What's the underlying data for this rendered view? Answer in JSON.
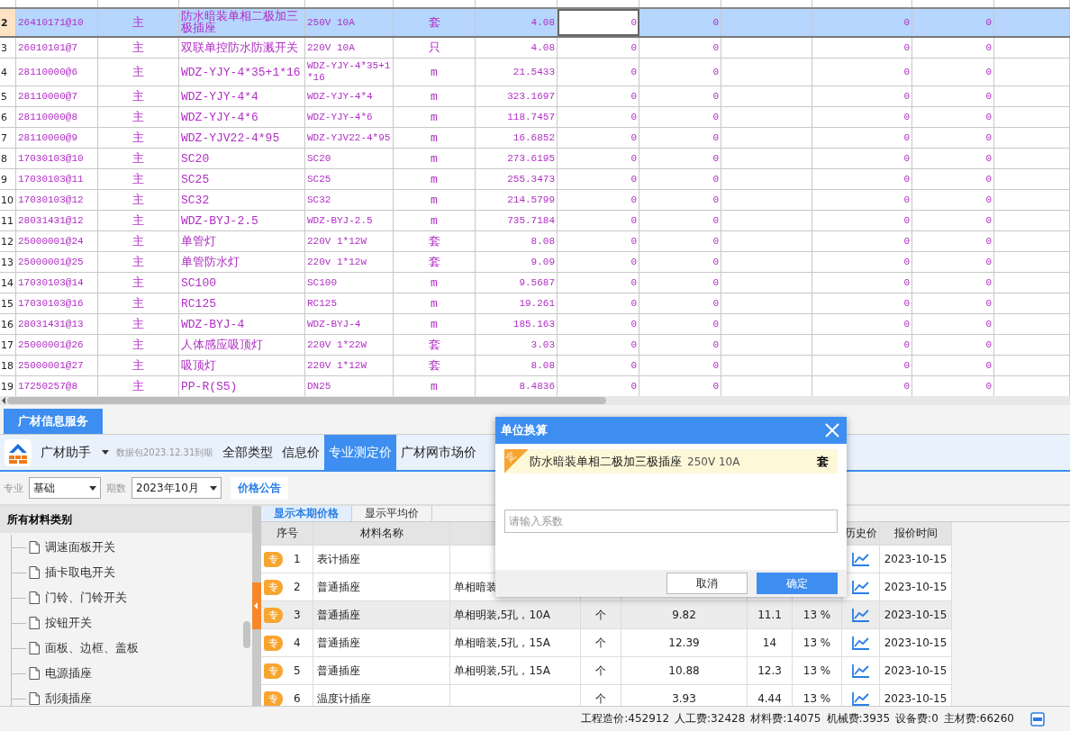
{
  "grid": {
    "rows": [
      {
        "num": "2",
        "code": "26410171@10",
        "type": "主",
        "name": "防水暗装单相二极加三极插座",
        "spec": "250V 10A",
        "unit": "套",
        "qty": "4.08",
        "column_7": "0",
        "column_8": "0",
        "column_10": "0",
        "column_11": "0",
        "selected": true
      },
      {
        "num": "3",
        "code": "26010101@7",
        "type": "主",
        "name": "双联单控防水防溅开关",
        "spec": "220V 10A",
        "unit": "只",
        "qty": "4.08",
        "column_7": "0",
        "column_8": "0",
        "column_10": "0",
        "column_11": "0",
        "selected": false
      },
      {
        "num": "4",
        "code": "28110000@6",
        "type": "主",
        "name": "WDZ-YJY-4*35+1*16",
        "spec": "WDZ-YJY-4*35+1*16",
        "unit": "m",
        "qty": "21.5433",
        "column_7": "0",
        "column_8": "0",
        "column_10": "0",
        "column_11": "0",
        "selected": false
      },
      {
        "num": "5",
        "code": "28110000@7",
        "type": "主",
        "name": "WDZ-YJY-4*4",
        "spec": "WDZ-YJY-4*4",
        "unit": "m",
        "qty": "323.1697",
        "column_7": "0",
        "column_8": "0",
        "column_10": "0",
        "column_11": "0",
        "selected": false
      },
      {
        "num": "6",
        "code": "28110000@8",
        "type": "主",
        "name": "WDZ-YJY-4*6",
        "spec": "WDZ-YJY-4*6",
        "unit": "m",
        "qty": "118.7457",
        "column_7": "0",
        "column_8": "0",
        "column_10": "0",
        "column_11": "0",
        "selected": false
      },
      {
        "num": "7",
        "code": "28110000@9",
        "type": "主",
        "name": "WDZ-YJV22-4*95",
        "spec": "WDZ-YJV22-4*95",
        "unit": "m",
        "qty": "16.6852",
        "column_7": "0",
        "column_8": "0",
        "column_10": "0",
        "column_11": "0",
        "selected": false
      },
      {
        "num": "8",
        "code": "17030103@10",
        "type": "主",
        "name": "SC20",
        "spec": "SC20",
        "unit": "m",
        "qty": "273.6195",
        "column_7": "0",
        "column_8": "0",
        "column_10": "0",
        "column_11": "0",
        "selected": false
      },
      {
        "num": "9",
        "code": "17030103@11",
        "type": "主",
        "name": "SC25",
        "spec": "SC25",
        "unit": "m",
        "qty": "255.3473",
        "column_7": "0",
        "column_8": "0",
        "column_10": "0",
        "column_11": "0",
        "selected": false
      },
      {
        "num": "10",
        "code": "17030103@12",
        "type": "主",
        "name": "SC32",
        "spec": "SC32",
        "unit": "m",
        "qty": "214.5799",
        "column_7": "0",
        "column_8": "0",
        "column_10": "0",
        "column_11": "0",
        "selected": false
      },
      {
        "num": "11",
        "code": "28031431@12",
        "type": "主",
        "name": "WDZ-BYJ-2.5",
        "spec": "WDZ-BYJ-2.5",
        "unit": "m",
        "qty": "735.7184",
        "column_7": "0",
        "column_8": "0",
        "column_10": "0",
        "column_11": "0",
        "selected": false
      },
      {
        "num": "12",
        "code": "25000001@24",
        "type": "主",
        "name": "单管灯",
        "spec": "220V 1*12W",
        "unit": "套",
        "qty": "8.08",
        "column_7": "0",
        "column_8": "0",
        "column_10": "0",
        "column_11": "0",
        "selected": false
      },
      {
        "num": "13",
        "code": "25000001@25",
        "type": "主",
        "name": "单管防水灯",
        "spec": "220v 1*12w",
        "unit": "套",
        "qty": "9.09",
        "column_7": "0",
        "column_8": "0",
        "column_10": "0",
        "column_11": "0",
        "selected": false
      },
      {
        "num": "14",
        "code": "17030103@14",
        "type": "主",
        "name": "SC100",
        "spec": "SC100",
        "unit": "m",
        "qty": "9.5687",
        "column_7": "0",
        "column_8": "0",
        "column_10": "0",
        "column_11": "0",
        "selected": false
      },
      {
        "num": "15",
        "code": "17030103@16",
        "type": "主",
        "name": "RC125",
        "spec": "RC125",
        "unit": "m",
        "qty": "19.261",
        "column_7": "0",
        "column_8": "0",
        "column_10": "0",
        "column_11": "0",
        "selected": false
      },
      {
        "num": "16",
        "code": "28031431@13",
        "type": "主",
        "name": "WDZ-BYJ-4",
        "spec": "WDZ-BYJ-4",
        "unit": "m",
        "qty": "185.163",
        "column_7": "0",
        "column_8": "0",
        "column_10": "0",
        "column_11": "0",
        "selected": false
      },
      {
        "num": "17",
        "code": "25000001@26",
        "type": "主",
        "name": "人体感应吸顶灯",
        "spec": "220V 1*22W",
        "unit": "套",
        "qty": "3.03",
        "column_7": "0",
        "column_8": "0",
        "column_10": "0",
        "column_11": "0",
        "selected": false
      },
      {
        "num": "18",
        "code": "25000001@27",
        "type": "主",
        "name": "吸顶灯",
        "spec": "220V 1*12W",
        "unit": "套",
        "qty": "8.08",
        "column_7": "0",
        "column_8": "0",
        "column_10": "0",
        "column_11": "0",
        "selected": false
      },
      {
        "num": "19",
        "code": "17250257@8",
        "type": "主",
        "name": "PP-R(S5)",
        "spec": "DN25",
        "unit": "m",
        "qty": "8.4836",
        "column_7": "0",
        "column_8": "0",
        "column_10": "0",
        "column_11": "0",
        "selected": false
      }
    ]
  },
  "info_panel": {
    "tab": "广材信息服务",
    "assistant": "广材助手",
    "expiry": "数据包2023.12.31到期",
    "tabs": [
      {
        "label": "全部类型",
        "selected": false
      },
      {
        "label": "信息价",
        "selected": false
      },
      {
        "label": "专业测定价",
        "selected": true
      },
      {
        "label": "广材网市场价",
        "selected": false
      }
    ],
    "filters": [
      {
        "label": "专业",
        "value": "基础"
      },
      {
        "label": "期数",
        "value": "2023年10月"
      }
    ],
    "announcement_button": "价格公告"
  },
  "categories": {
    "title": "所有材料类别",
    "items": [
      "调速面板开关",
      "插卡取电开关",
      "门铃、门铃开关",
      "按钮开关",
      "面板、边框、盖板",
      "电源插座",
      "刮须插座"
    ]
  },
  "price_table": {
    "view_tabs": [
      {
        "label": "显示本期价格",
        "selected": true
      },
      {
        "label": "显示平均价",
        "selected": false
      }
    ],
    "columns": {
      "index": "序号",
      "name": "材料名称",
      "history": "历史价",
      "date": "报价时间"
    },
    "rows": [
      {
        "badge": "专",
        "index": "1",
        "name": "表计插座",
        "date": "2023-10-15",
        "selected": false
      },
      {
        "badge": "专",
        "index": "2",
        "name": "普通插座",
        "spec": "单相暗装",
        "date": "2023-10-15",
        "selected": false
      },
      {
        "badge": "专",
        "index": "3",
        "name": "普通插座",
        "spec": "单相明装,5孔，10A",
        "unit": "个",
        "price": "9.82",
        "tax_price": "11.1",
        "tax": "13 %",
        "date": "2023-10-15",
        "selected": true
      },
      {
        "badge": "专",
        "index": "4",
        "name": "普通插座",
        "spec": "单相暗装,5孔，15A",
        "unit": "个",
        "price": "12.39",
        "tax_price": "14",
        "tax": "13 %",
        "date": "2023-10-15",
        "selected": false
      },
      {
        "badge": "专",
        "index": "5",
        "name": "普通插座",
        "spec": "单相明装,5孔，15A",
        "unit": "个",
        "price": "10.88",
        "tax_price": "12.3",
        "tax": "13 %",
        "date": "2023-10-15",
        "selected": false
      },
      {
        "badge": "专",
        "index": "6",
        "name": "温度计插座",
        "unit": "个",
        "price": "3.93",
        "tax_price": "4.44",
        "tax": "13 %",
        "date": "2023-10-15",
        "selected": false
      }
    ]
  },
  "dialog": {
    "title": "单位换算",
    "item": {
      "tag": "定",
      "name": "防水暗装单相二极加三极插座",
      "spec": "250V 10A",
      "unit": "套"
    },
    "input": {
      "placeholder": "请输入系数"
    },
    "buttons": [
      {
        "label": "取消",
        "kind": "secondary"
      },
      {
        "label": "确定",
        "kind": "primary"
      }
    ]
  },
  "status_bar": [
    "工程造价:452912",
    "人工费:32428",
    "材料费:14075",
    "机械费:3935",
    "设备费:0",
    "主材费:66260"
  ]
}
